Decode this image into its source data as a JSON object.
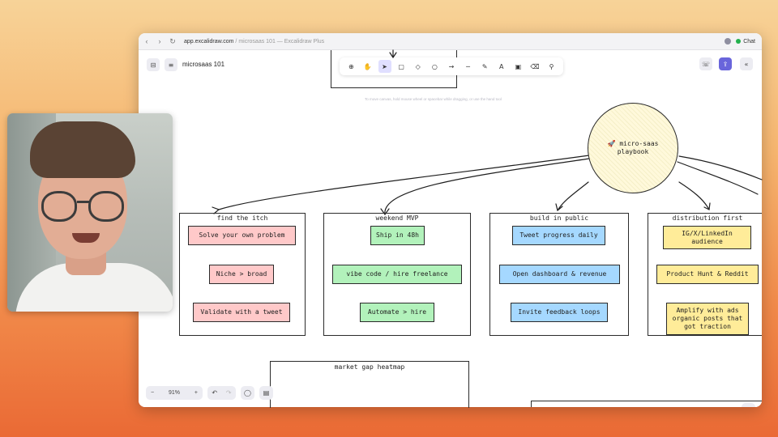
{
  "browser": {
    "url_host": "app.excalidraw.com",
    "url_rest": " / microsaas 101 — Excalidraw Plus",
    "chat_label": "Chat"
  },
  "app": {
    "doc_title": "microsaas 101",
    "hint": "To move canvas, hold mouse wheel or spacebar while dragging, or use the hand tool",
    "zoom": "91%"
  },
  "board": {
    "center": {
      "emoji": "🚀",
      "line1": "micro-saas",
      "line2": "playbook"
    },
    "columns": [
      {
        "title": "find the itch",
        "cards": [
          "Solve your own problem",
          "Niche > broad",
          "Validate with a tweet"
        ]
      },
      {
        "title": "weekend MVP",
        "cards": [
          "Ship in 48h",
          "vibe code / hire freelance",
          "Automate > hire"
        ]
      },
      {
        "title": "build in public",
        "cards": [
          "Tweet progress daily",
          "Open dashboard & revenue",
          "Invite feedback loops"
        ]
      },
      {
        "title": "distribution first",
        "cards": [
          "IG/X/LinkedIn audience",
          "Product Hunt & Reddit",
          "Amplify with ads organic posts that got traction"
        ]
      }
    ],
    "heatmap_title": "market gap heatmap"
  },
  "colors": {
    "pink": "#ffc9c9",
    "green": "#b2f2bb",
    "blue": "#a5d8ff",
    "yellow": "#ffec99",
    "accent": "#6965db"
  }
}
